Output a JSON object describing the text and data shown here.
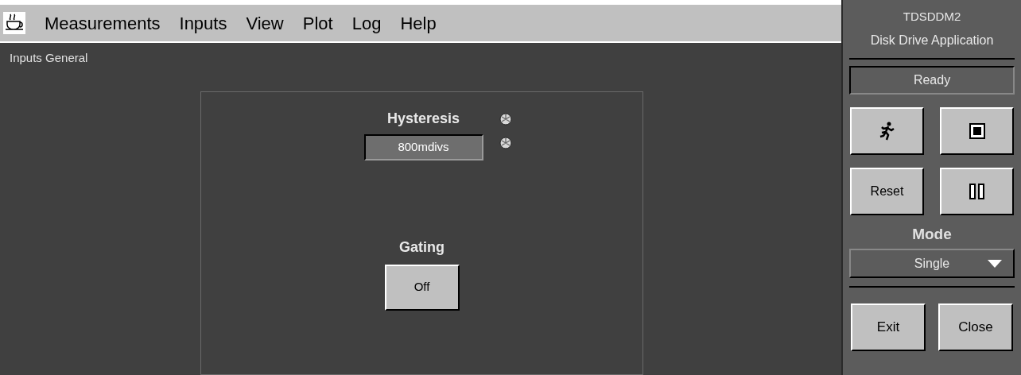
{
  "menu_bar": {
    "items": [
      "Measurements",
      "Inputs",
      "View",
      "Plot",
      "Log",
      "Help"
    ]
  },
  "page_title": "Inputs General",
  "hysteresis": {
    "label": "Hysteresis",
    "value": "800mdivs"
  },
  "gating": {
    "label": "Gating",
    "button": "Off"
  },
  "side_panel": {
    "title": "TDSDDM2",
    "subtitle": "Disk Drive Application",
    "status": "Ready",
    "controls": [
      {
        "kind": "run"
      },
      {
        "kind": "stop"
      },
      {
        "kind": "text",
        "label": "Reset"
      },
      {
        "kind": "pause"
      }
    ],
    "mode": {
      "label": "Mode",
      "value": "Single"
    },
    "buttons": [
      "Exit",
      "Close"
    ]
  }
}
